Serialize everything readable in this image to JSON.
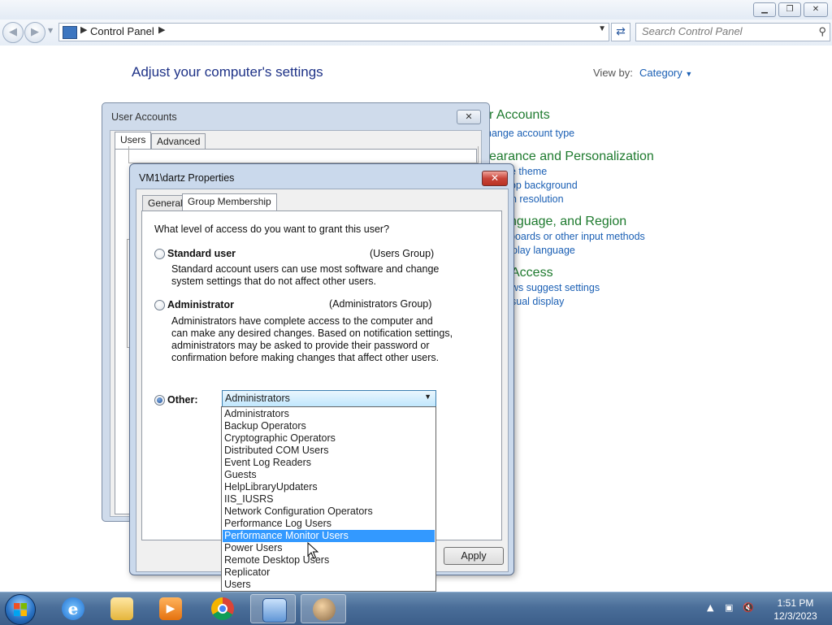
{
  "control_panel": {
    "address_crumb": "Control Panel",
    "search_placeholder": "Search Control Panel",
    "header": "Adjust your computer's settings",
    "view_by_label": "View by:",
    "view_by_value": "Category",
    "categories": [
      {
        "title": "r Accounts",
        "links": [
          "hange account type"
        ]
      },
      {
        "title": "earance and Personalization",
        "links": [
          "e theme",
          "sktop background",
          "en resolution"
        ]
      },
      {
        "title": "nguage, and Region",
        "links": [
          "boards or other input methods",
          "play language"
        ]
      },
      {
        "title": "Access",
        "links": [
          "ws suggest settings",
          "sual display"
        ]
      }
    ]
  },
  "user_accounts_dialog": {
    "title": "User Accounts",
    "tabs": [
      "Users",
      "Advanced"
    ]
  },
  "properties_dialog": {
    "title": "VM1\\dartz Properties",
    "tabs": [
      "General",
      "Group Membership"
    ],
    "question": "What level of access do you want to grant this user?",
    "standard": {
      "label": "Standard user",
      "group": "(Users Group)",
      "desc": [
        "Standard account users can use most software and change",
        "system settings that do not affect other users."
      ]
    },
    "admin": {
      "label": "Administrator",
      "group": "(Administrators Group)",
      "desc": [
        "Administrators have complete access to the computer and",
        "can make any desired changes. Based on notification settings,",
        "administrators may be asked to provide their password or",
        "confirmation before making changes that affect other users."
      ]
    },
    "other": {
      "label": "Other:",
      "selected_value": "Administrators"
    },
    "apply_label": "Apply"
  },
  "dropdown": {
    "options": [
      "Administrators",
      "Backup Operators",
      "Cryptographic Operators",
      "Distributed COM Users",
      "Event Log Readers",
      "Guests",
      "HelpLibraryUpdaters",
      "IIS_IUSRS",
      "Network Configuration Operators",
      "Performance Log Users",
      "Performance Monitor Users",
      "Power Users",
      "Remote Desktop Users",
      "Replicator",
      "Users"
    ],
    "highlighted": "Performance Monitor Users"
  },
  "taskbar": {
    "time": "1:51 PM",
    "date": "12/3/2023",
    "apps": [
      "internet-explorer-icon",
      "file-explorer-icon",
      "media-player-icon",
      "chrome-icon",
      "control-panel-icon",
      "user-accounts-icon"
    ]
  },
  "colors": {
    "accent_link": "#1a5fb4",
    "category_green": "#1e7a2e",
    "selection": "#3399ff"
  }
}
